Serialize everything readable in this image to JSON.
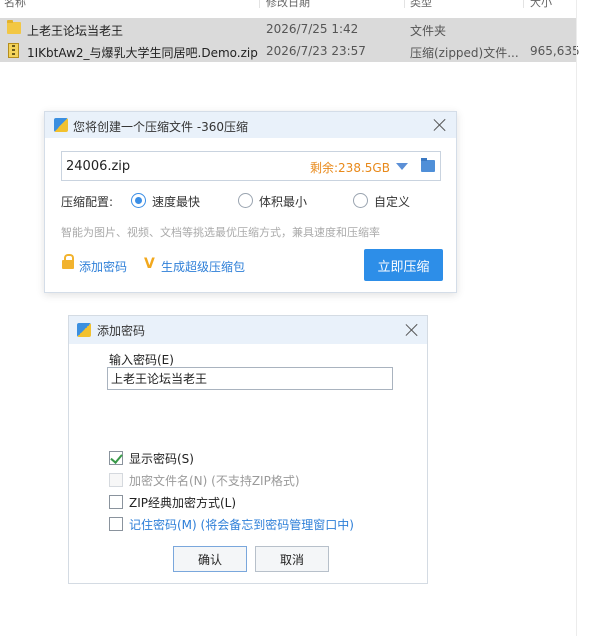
{
  "explorer": {
    "columns": [
      "名称",
      "修改日期",
      "类型",
      "大小"
    ],
    "files": [
      {
        "name": "上老王论坛当老王",
        "date": "2026/7/25 1:42",
        "type": "文件夹",
        "size": ""
      },
      {
        "name": "1IKbtAw2_与爆乳大学生同居吧.Demo.zip",
        "date": "2026/7/23 23:57",
        "type": "压缩(zipped)文件...",
        "size": "965,635"
      }
    ]
  },
  "compress_dialog": {
    "title": "您将创建一个压缩文件 -360压缩",
    "filename": "24006.zip",
    "remaining_space": "剩余:238.5GB",
    "config_label": "压缩配置:",
    "options": [
      "速度最快",
      "体积最小",
      "自定义"
    ],
    "selected_option": "速度最快",
    "hint": "智能为图片、视频、文档等挑选最优压缩方式，兼具速度和压缩率",
    "add_password_link": "添加密码",
    "super_compress_link": "生成超级压缩包",
    "compress_button": "立即压缩"
  },
  "password_dialog": {
    "title": "添加密码",
    "input_label": "输入密码(E)",
    "password_value": "上老王论坛当老王",
    "checkboxes": [
      {
        "label": "显示密码(S)",
        "checked": true,
        "enabled": true
      },
      {
        "label": "加密文件名(N) (不支持ZIP格式)",
        "checked": false,
        "enabled": false
      },
      {
        "label": "ZIP经典加密方式(L)",
        "checked": false,
        "enabled": true
      },
      {
        "label": "记住密码(M) (将会备忘到密码管理窗口中)",
        "checked": false,
        "enabled": true
      }
    ],
    "ok_button": "确认",
    "cancel_button": "取消"
  },
  "colors": {
    "accent": "#2d8ee8",
    "remaining_space": "#e8891a",
    "link": "#2e7fd8"
  }
}
